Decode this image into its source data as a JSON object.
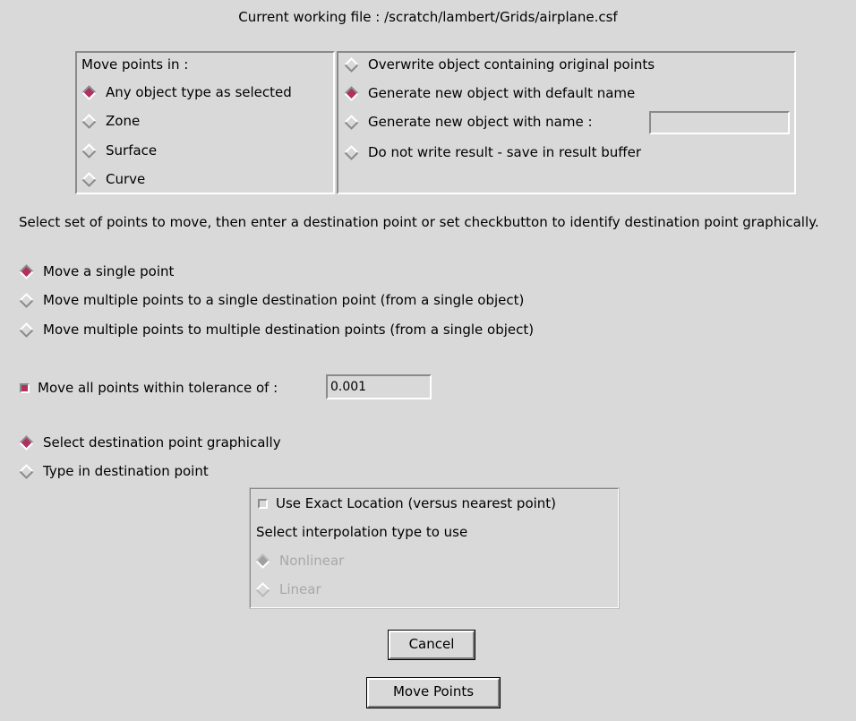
{
  "header": {
    "working_file": "Current working file : /scratch/lambert/Grids/airplane.csf"
  },
  "object_type": {
    "label": "Move points in :",
    "options": [
      {
        "label": "Any object type as selected",
        "selected": true
      },
      {
        "label": "Zone",
        "selected": false
      },
      {
        "label": "Surface",
        "selected": false
      },
      {
        "label": "Curve",
        "selected": false
      }
    ]
  },
  "output": {
    "options": [
      {
        "label": "Overwrite object containing original points",
        "selected": false
      },
      {
        "label": "Generate new object with default name",
        "selected": true
      },
      {
        "label": "Generate new object with name :",
        "selected": false
      },
      {
        "label": "Do not write result - save in result buffer",
        "selected": false
      }
    ],
    "name_value": ""
  },
  "instructions": "Select set of points to move, then  enter a destination point or set checkbutton to identify destination  point graphically.",
  "move_mode": {
    "options": [
      {
        "label": "Move a single point",
        "selected": true
      },
      {
        "label": "Move multiple points to a single destination point (from a single object)",
        "selected": false
      },
      {
        "label": "Move multiple points to multiple destination points (from a single object)",
        "selected": false
      }
    ]
  },
  "tolerance": {
    "label": "Move all points within tolerance of :",
    "checked": true,
    "value": "0.001"
  },
  "destination": {
    "options": [
      {
        "label": "Select destination point graphically",
        "selected": true
      },
      {
        "label": "Type in destination point",
        "selected": false
      }
    ]
  },
  "exact": {
    "checkbox_label": "Use Exact Location (versus nearest point)",
    "checked": false,
    "interp_label": "Select interpolation type to use",
    "options": [
      {
        "label": "Nonlinear",
        "selected": true
      },
      {
        "label": "Linear",
        "selected": false
      }
    ]
  },
  "buttons": {
    "cancel": "Cancel",
    "move": "Move Points"
  },
  "colors": {
    "background": "#d9d9d9",
    "accent": "#b03060",
    "disabled": "#a8a8a8"
  }
}
